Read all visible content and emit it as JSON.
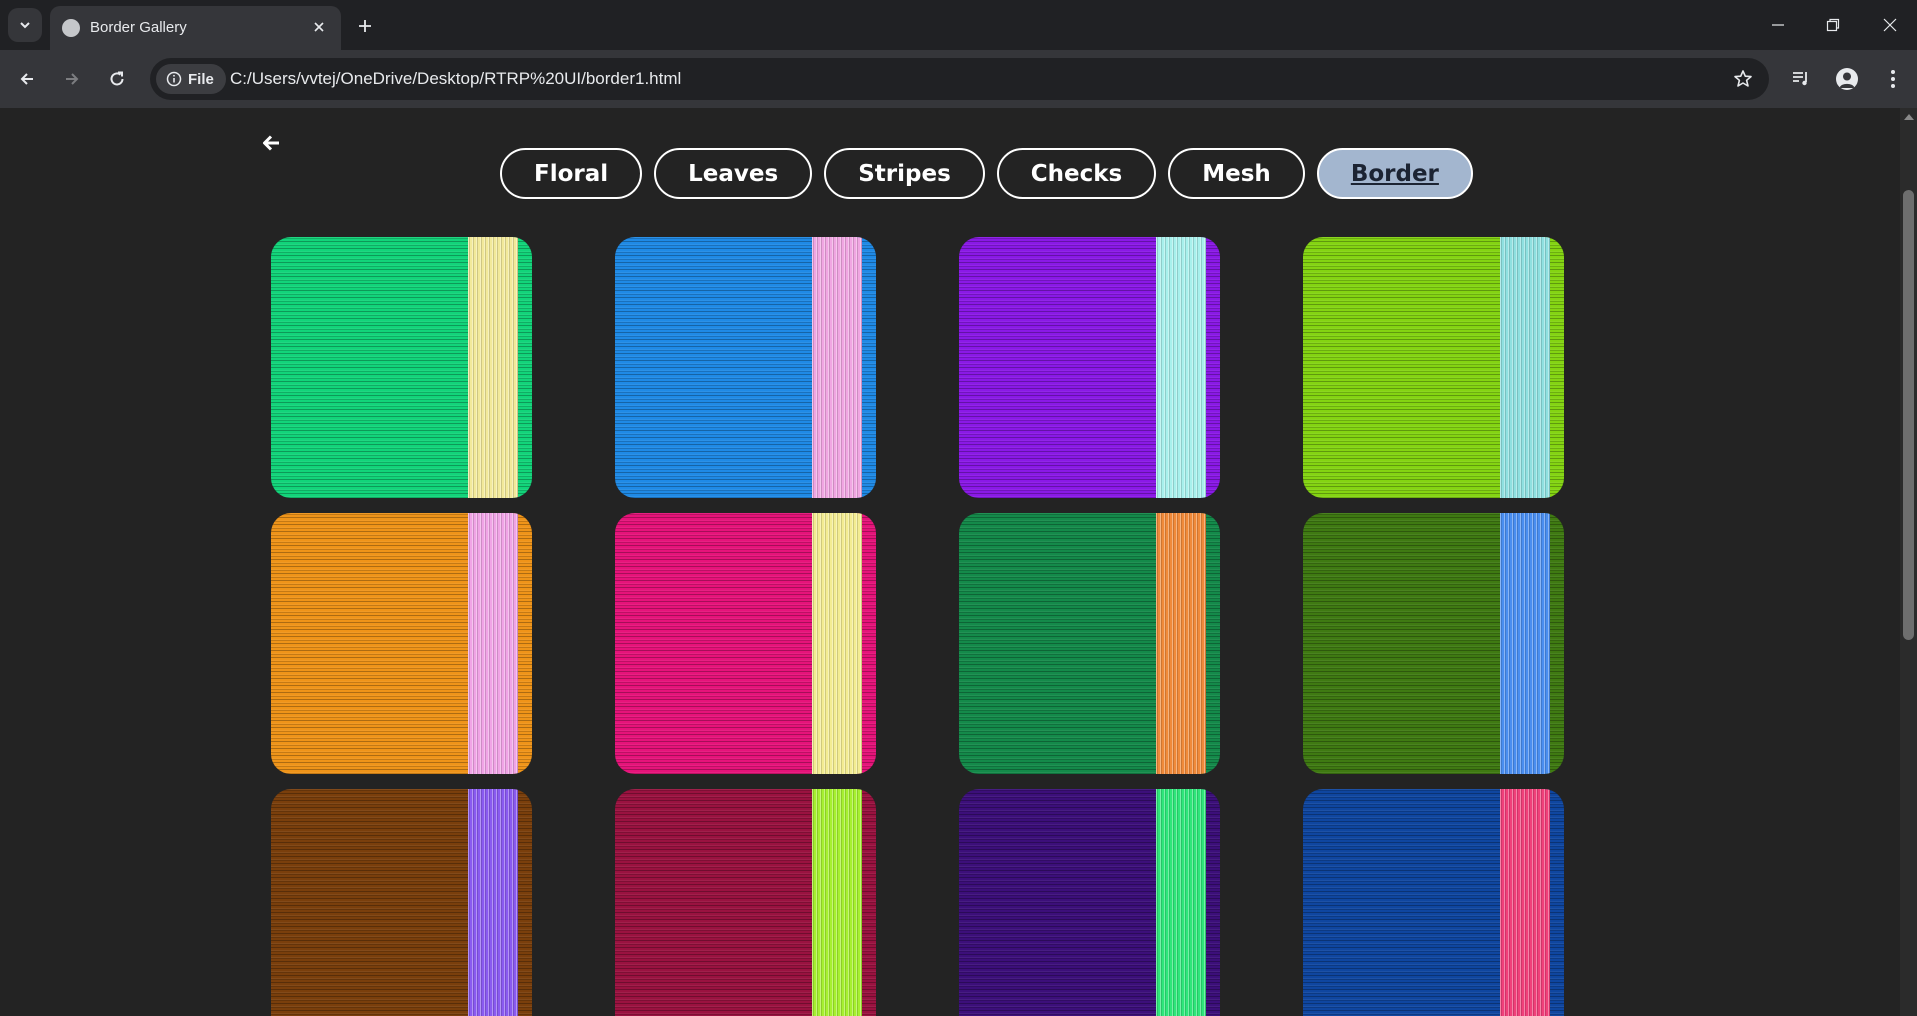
{
  "browser": {
    "tab_title": "Border Gallery",
    "site_chip_label": "File",
    "url": "C:/Users/vvtej/OneDrive/Desktop/RTRP%20UI/border1.html"
  },
  "nav": {
    "categories": [
      {
        "label": "Floral",
        "active": false
      },
      {
        "label": "Leaves",
        "active": false
      },
      {
        "label": "Stripes",
        "active": false
      },
      {
        "label": "Checks",
        "active": false
      },
      {
        "label": "Mesh",
        "active": false
      },
      {
        "label": "Border",
        "active": true
      }
    ]
  },
  "tiles": [
    {
      "base": "#12d47a",
      "border": "#f2e99a"
    },
    {
      "base": "#1f8ae6",
      "border": "#f0a6e2"
    },
    {
      "base": "#8a19e6",
      "border": "#a8f0ec"
    },
    {
      "base": "#84d412",
      "border": "#8fe0e0"
    },
    {
      "base": "#ef9419",
      "border": "#f0a4e6"
    },
    {
      "base": "#e6137a",
      "border": "#f3ec92"
    },
    {
      "base": "#148a4a",
      "border": "#f08a3a"
    },
    {
      "base": "#3f7a12",
      "border": "#4a8ef0"
    },
    {
      "base": "#7a3f0c",
      "border": "#8a5af0"
    },
    {
      "base": "#9a1240",
      "border": "#a6f030"
    },
    {
      "base": "#3c0f7a",
      "border": "#2ee67a"
    },
    {
      "base": "#0f46a0",
      "border": "#f0407a"
    }
  ],
  "colors": {
    "page_bg": "#232323",
    "active_button_bg": "#a3b6cf"
  }
}
